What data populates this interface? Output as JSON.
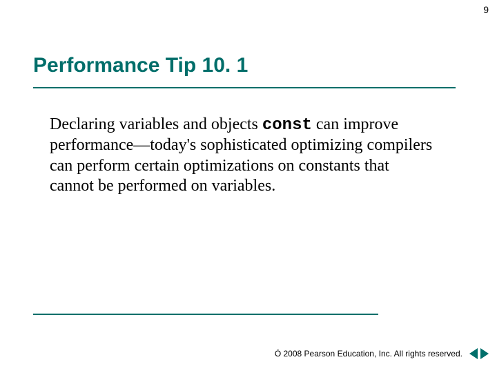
{
  "page_number": "9",
  "title": "Performance Tip 10. 1",
  "body": {
    "pre": "Declaring variables and objects ",
    "code": "const",
    "post": " can improve performance—today's sophisticated optimizing compilers can perform certain optimizations on constants that cannot be performed on variables."
  },
  "footer": {
    "copyright_symbol": "Ó",
    "text": " 2008 Pearson Education, Inc.  All rights reserved."
  }
}
